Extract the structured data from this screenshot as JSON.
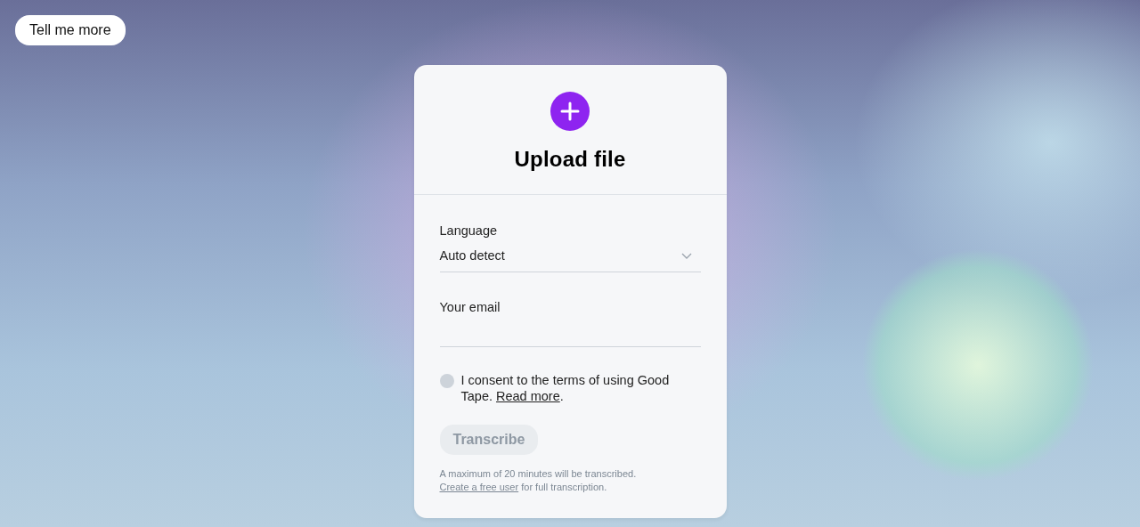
{
  "hero_button": {
    "label": "Tell me more"
  },
  "upload_card": {
    "title": "Upload file",
    "language": {
      "label": "Language",
      "value": "Auto detect"
    },
    "email": {
      "label": "Your email"
    },
    "consent": {
      "text": "I consent to the terms of using Good Tape. ",
      "link": "Read more",
      "after": ".",
      "checked": false
    },
    "transcribe": {
      "label": "Transcribe",
      "disabled": true
    },
    "note": {
      "line": "A maximum of 20 minutes will be transcribed.",
      "link": "Create a free user",
      "after": " for full transcription."
    }
  }
}
